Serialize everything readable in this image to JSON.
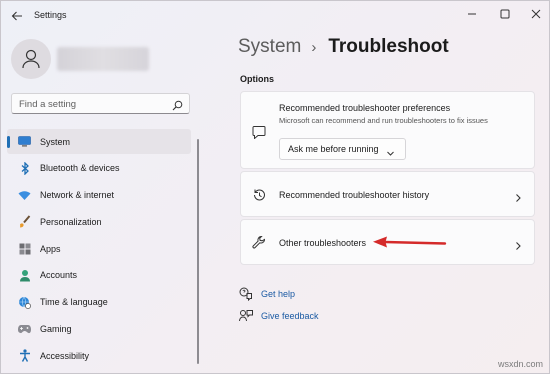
{
  "window": {
    "title": "Settings"
  },
  "profile": {
    "name_hidden": true
  },
  "search": {
    "placeholder": "Find a setting"
  },
  "sidebar": {
    "items": [
      {
        "label": "System",
        "icon": "monitor-icon",
        "active": true
      },
      {
        "label": "Bluetooth & devices",
        "icon": "bluetooth-icon"
      },
      {
        "label": "Network & internet",
        "icon": "wifi-icon"
      },
      {
        "label": "Personalization",
        "icon": "paintbrush-icon"
      },
      {
        "label": "Apps",
        "icon": "apps-icon"
      },
      {
        "label": "Accounts",
        "icon": "person-icon"
      },
      {
        "label": "Time & language",
        "icon": "globe-clock-icon"
      },
      {
        "label": "Gaming",
        "icon": "gamepad-icon"
      },
      {
        "label": "Accessibility",
        "icon": "accessibility-icon"
      }
    ]
  },
  "breadcrumb": {
    "parent": "System",
    "separator": "›",
    "current": "Troubleshoot"
  },
  "options": {
    "title": "Options",
    "preferences": {
      "title": "Recommended troubleshooter preferences",
      "description": "Microsoft can recommend and run troubleshooters to fix issues",
      "dropdown_value": "Ask me before running"
    },
    "history": {
      "title": "Recommended troubleshooter history"
    },
    "other": {
      "title": "Other troubleshooters"
    }
  },
  "links": {
    "get_help": "Get help",
    "give_feedback": "Give feedback"
  },
  "watermark": "wsxdn.com",
  "colors": {
    "accent": "#1f6fb5",
    "link": "#1b5aa3",
    "annotation_arrow": "#d42a2a"
  }
}
